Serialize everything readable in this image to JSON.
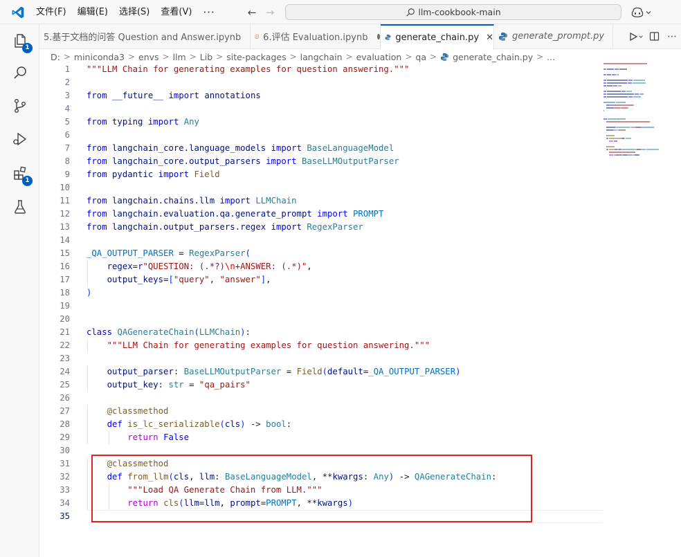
{
  "titlebar": {
    "menu": [
      "文件(F)",
      "编辑(E)",
      "选择(S)",
      "查看(V)"
    ],
    "more": "···",
    "search_text": "llm-cookbook-main"
  },
  "activity": {
    "explorer_badge": "1",
    "extensions_badge": "1"
  },
  "tabs": [
    {
      "label": "5.基于文档的问答 Question and Answer.ipynb",
      "state": "inactive"
    },
    {
      "label": "6.评估 Evaluation.ipynb",
      "state": "modified"
    },
    {
      "label": "generate_chain.py",
      "state": "active"
    },
    {
      "label": "generate_prompt.py",
      "state": "preview"
    }
  ],
  "breadcrumb": [
    "D:",
    "miniconda3",
    "envs",
    "llm",
    "Lib",
    "site-packages",
    "langchain",
    "evaluation",
    "qa",
    "generate_chain.py",
    "..."
  ],
  "code_lines": [
    [
      [
        "str",
        "\"\"\"LLM Chain for generating examples for question answering.\"\"\""
      ]
    ],
    [],
    [
      [
        "kw",
        "from"
      ],
      [
        "p",
        " "
      ],
      [
        "var",
        "__future__"
      ],
      [
        "p",
        " "
      ],
      [
        "kw",
        "import"
      ],
      [
        "p",
        " "
      ],
      [
        "var",
        "annotations"
      ]
    ],
    [],
    [
      [
        "kw",
        "from"
      ],
      [
        "p",
        " "
      ],
      [
        "var",
        "typing"
      ],
      [
        "p",
        " "
      ],
      [
        "kw",
        "import"
      ],
      [
        "p",
        " "
      ],
      [
        "cls",
        "Any"
      ]
    ],
    [],
    [
      [
        "kw",
        "from"
      ],
      [
        "p",
        " "
      ],
      [
        "var",
        "langchain_core.language_models"
      ],
      [
        "p",
        " "
      ],
      [
        "kw",
        "import"
      ],
      [
        "p",
        " "
      ],
      [
        "cls",
        "BaseLanguageModel"
      ]
    ],
    [
      [
        "kw",
        "from"
      ],
      [
        "p",
        " "
      ],
      [
        "var",
        "langchain_core.output_parsers"
      ],
      [
        "p",
        " "
      ],
      [
        "kw",
        "import"
      ],
      [
        "p",
        " "
      ],
      [
        "cls",
        "BaseLLMOutputParser"
      ]
    ],
    [
      [
        "kw",
        "from"
      ],
      [
        "p",
        " "
      ],
      [
        "var",
        "pydantic"
      ],
      [
        "p",
        " "
      ],
      [
        "kw",
        "import"
      ],
      [
        "p",
        " "
      ],
      [
        "fn",
        "Field"
      ]
    ],
    [],
    [
      [
        "kw",
        "from"
      ],
      [
        "p",
        " "
      ],
      [
        "var",
        "langchain.chains.llm"
      ],
      [
        "p",
        " "
      ],
      [
        "kw",
        "import"
      ],
      [
        "p",
        " "
      ],
      [
        "cls",
        "LLMChain"
      ]
    ],
    [
      [
        "kw",
        "from"
      ],
      [
        "p",
        " "
      ],
      [
        "var",
        "langchain.evaluation.qa.generate_prompt"
      ],
      [
        "p",
        " "
      ],
      [
        "kw",
        "import"
      ],
      [
        "p",
        " "
      ],
      [
        "const",
        "PROMPT"
      ]
    ],
    [
      [
        "kw",
        "from"
      ],
      [
        "p",
        " "
      ],
      [
        "var",
        "langchain.output_parsers.regex"
      ],
      [
        "p",
        " "
      ],
      [
        "kw",
        "import"
      ],
      [
        "p",
        " "
      ],
      [
        "cls",
        "RegexParser"
      ]
    ],
    [],
    [
      [
        "const",
        "_QA_OUTPUT_PARSER"
      ],
      [
        "p",
        " = "
      ],
      [
        "cls",
        "RegexParser"
      ],
      [
        "par",
        "("
      ]
    ],
    [
      [
        "p",
        "    "
      ],
      [
        "var",
        "regex"
      ],
      [
        "p",
        "="
      ],
      [
        "kw",
        "r"
      ],
      [
        "str",
        "\"QUESTION: "
      ],
      [
        "re",
        "(.*?)"
      ],
      [
        "esc",
        "\\n"
      ],
      [
        "str",
        "+ANSWER: "
      ],
      [
        "re",
        "(.*)"
      ],
      [
        "str",
        "\""
      ],
      [
        "p",
        ","
      ]
    ],
    [
      [
        "p",
        "    "
      ],
      [
        "var",
        "output_keys"
      ],
      [
        "p",
        "="
      ],
      [
        "par",
        "["
      ],
      [
        "str",
        "\"query\""
      ],
      [
        "p",
        ", "
      ],
      [
        "str",
        "\"answer\""
      ],
      [
        "par",
        "]"
      ],
      [
        "p",
        ","
      ]
    ],
    [
      [
        "par",
        ")"
      ]
    ],
    [],
    [],
    [
      [
        "kw",
        "class"
      ],
      [
        "p",
        " "
      ],
      [
        "cls",
        "QAGenerateChain"
      ],
      [
        "par",
        "("
      ],
      [
        "cls",
        "LLMChain"
      ],
      [
        "par",
        ")"
      ],
      [
        "p",
        ":"
      ]
    ],
    [
      [
        "p",
        "    "
      ],
      [
        "str",
        "\"\"\"LLM Chain for generating examples for question answering.\"\"\""
      ]
    ],
    [],
    [
      [
        "p",
        "    "
      ],
      [
        "var",
        "output_parser"
      ],
      [
        "p",
        ": "
      ],
      [
        "cls",
        "BaseLLMOutputParser"
      ],
      [
        "p",
        " = "
      ],
      [
        "fn",
        "Field"
      ],
      [
        "par",
        "("
      ],
      [
        "var",
        "default"
      ],
      [
        "p",
        "="
      ],
      [
        "const",
        "_QA_OUTPUT_PARSER"
      ],
      [
        "par",
        ")"
      ]
    ],
    [
      [
        "p",
        "    "
      ],
      [
        "var",
        "output_key"
      ],
      [
        "p",
        ": "
      ],
      [
        "cls",
        "str"
      ],
      [
        "p",
        " = "
      ],
      [
        "str",
        "\"qa_pairs\""
      ]
    ],
    [],
    [
      [
        "p",
        "    "
      ],
      [
        "dec",
        "@classmethod"
      ]
    ],
    [
      [
        "p",
        "    "
      ],
      [
        "kw",
        "def"
      ],
      [
        "p",
        " "
      ],
      [
        "fn",
        "is_lc_serializable"
      ],
      [
        "par",
        "("
      ],
      [
        "var",
        "cls"
      ],
      [
        "par",
        ")"
      ],
      [
        "p",
        " -> "
      ],
      [
        "cls",
        "bool"
      ],
      [
        "p",
        ":"
      ]
    ],
    [
      [
        "p",
        "        "
      ],
      [
        "ctl",
        "return"
      ],
      [
        "p",
        " "
      ],
      [
        "kw",
        "False"
      ]
    ],
    [],
    [
      [
        "p",
        "    "
      ],
      [
        "dec",
        "@classmethod"
      ]
    ],
    [
      [
        "p",
        "    "
      ],
      [
        "kw",
        "def"
      ],
      [
        "p",
        " "
      ],
      [
        "fn",
        "from_llm"
      ],
      [
        "par",
        "("
      ],
      [
        "var",
        "cls"
      ],
      [
        "p",
        ", "
      ],
      [
        "var",
        "llm"
      ],
      [
        "p",
        ": "
      ],
      [
        "cls",
        "BaseLanguageModel"
      ],
      [
        "p",
        ", **"
      ],
      [
        "var",
        "kwargs"
      ],
      [
        "p",
        ": "
      ],
      [
        "cls",
        "Any"
      ],
      [
        "par",
        ")"
      ],
      [
        "p",
        " -> "
      ],
      [
        "cls",
        "QAGenerateChain"
      ],
      [
        "p",
        ":"
      ]
    ],
    [
      [
        "p",
        "        "
      ],
      [
        "str",
        "\"\"\"Load QA Generate Chain from LLM.\"\"\""
      ]
    ],
    [
      [
        "p",
        "        "
      ],
      [
        "ctl",
        "return"
      ],
      [
        "p",
        " "
      ],
      [
        "fn",
        "cls"
      ],
      [
        "par",
        "("
      ],
      [
        "var",
        "llm"
      ],
      [
        "p",
        "="
      ],
      [
        "var",
        "llm"
      ],
      [
        "p",
        ", "
      ],
      [
        "var",
        "prompt"
      ],
      [
        "p",
        "="
      ],
      [
        "const",
        "PROMPT"
      ],
      [
        "p",
        ", **"
      ],
      [
        "var",
        "kwargs"
      ],
      [
        "par",
        ")"
      ]
    ],
    []
  ],
  "colors": {
    "keyword": "#0000ff",
    "control": "#af00db",
    "string": "#a31515",
    "variable": "#001080",
    "class": "#267f99",
    "function": "#795e26",
    "constant": "#0070c1",
    "highlight_border": "#e02020",
    "accent": "#005fb8"
  }
}
